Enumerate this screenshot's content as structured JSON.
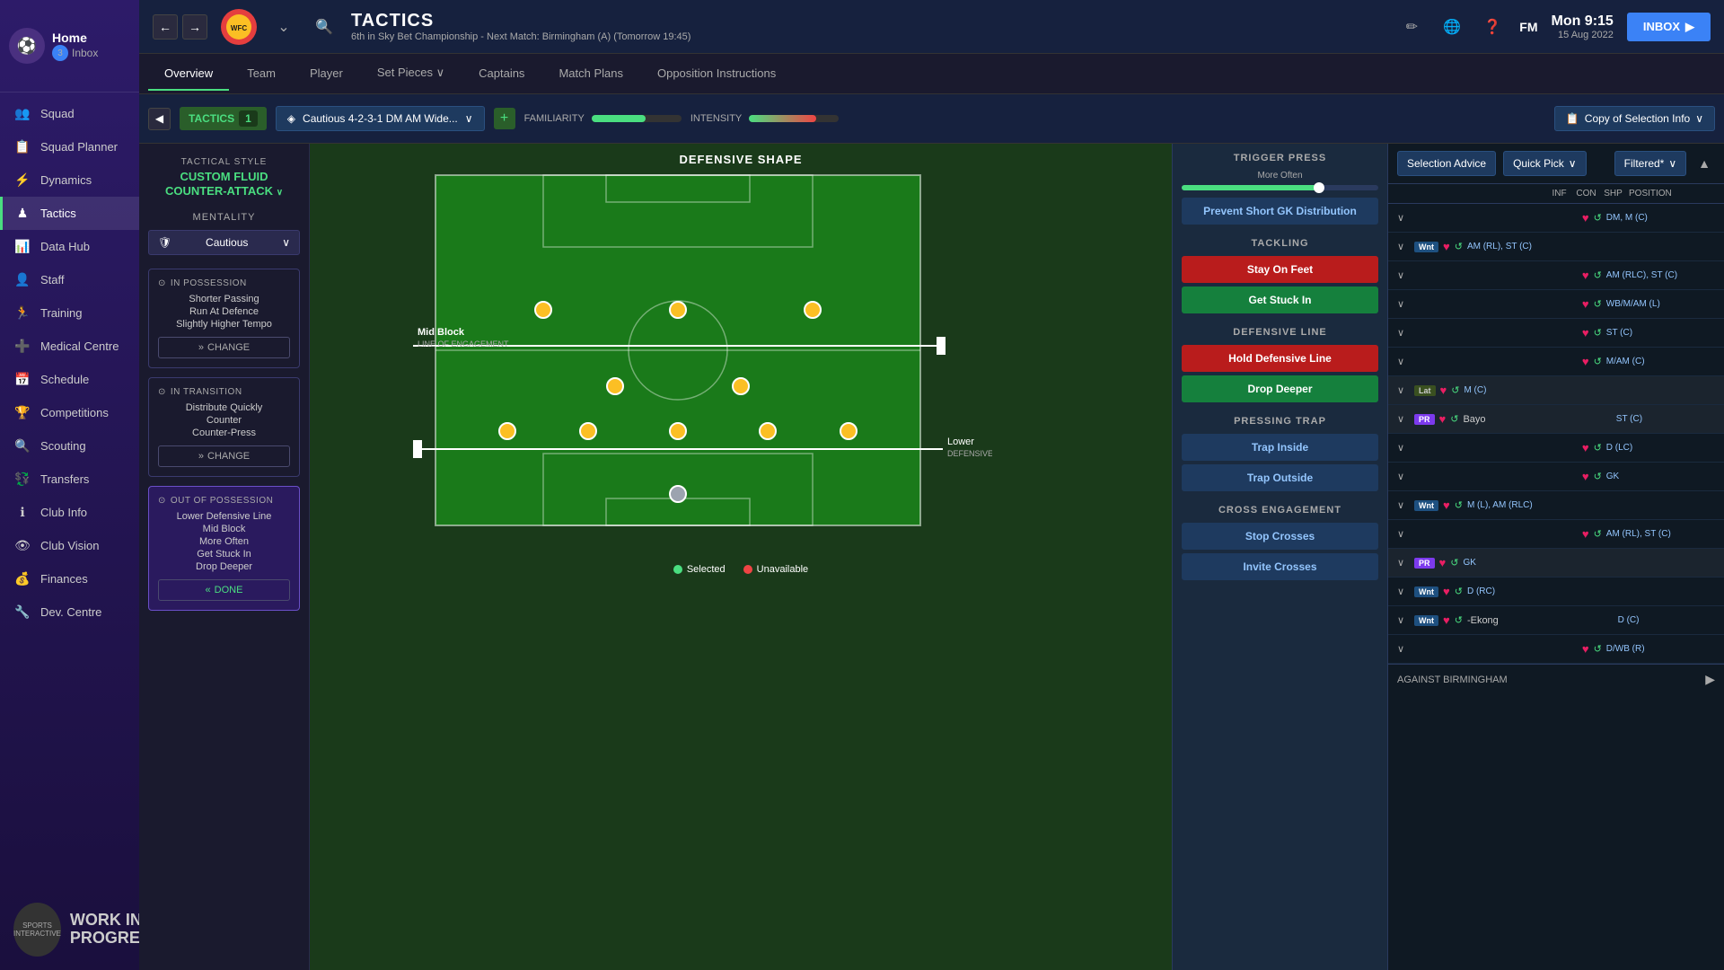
{
  "app": {
    "title": "TACTICS",
    "subtitle": "6th in Sky Bet Championship - Next Match: Birmingham (A) (Tomorrow 19:45)",
    "time": "Mon 9:15",
    "date": "15 Aug 2022",
    "fm_label": "FM",
    "inbox_label": "INBOX"
  },
  "sidebar": {
    "home_label": "Home",
    "inbox_label": "Inbox",
    "inbox_count": "3",
    "items": [
      {
        "label": "Squad",
        "icon": "👥"
      },
      {
        "label": "Squad Planner",
        "icon": "📋"
      },
      {
        "label": "Dynamics",
        "icon": "⚡"
      },
      {
        "label": "Tactics",
        "icon": "♟"
      },
      {
        "label": "Data Hub",
        "icon": "📊"
      },
      {
        "label": "Staff",
        "icon": "👤"
      },
      {
        "label": "Training",
        "icon": "🏃"
      },
      {
        "label": "Medical Centre",
        "icon": "➕"
      },
      {
        "label": "Schedule",
        "icon": "📅"
      },
      {
        "label": "Competitions",
        "icon": "🏆"
      },
      {
        "label": "Scouting",
        "icon": "🔍"
      },
      {
        "label": "Transfers",
        "icon": "💱"
      },
      {
        "label": "Club Info",
        "icon": "ℹ"
      },
      {
        "label": "Club Vision",
        "icon": "👁"
      },
      {
        "label": "Finances",
        "icon": "💰"
      },
      {
        "label": "Dev. Centre",
        "icon": "🔧"
      }
    ]
  },
  "secondnav": {
    "tabs": [
      "Overview",
      "Team",
      "Player",
      "Set Pieces",
      "Captains",
      "Match Plans",
      "Opposition Instructions"
    ]
  },
  "tacticsbar": {
    "label": "TACTICS",
    "num": "1",
    "formation": "Cautious 4-2-3-1 DM AM Wide...",
    "familiarity_label": "FAMILIARITY",
    "intensity_label": "INTENSITY",
    "copy_sel_label": "Copy of Selection Info"
  },
  "left_panel": {
    "tac_style_label": "TACTICAL STYLE",
    "tac_style_name": "CUSTOM FLUID\nCOUNTER-ATTACK",
    "mentality_label": "MENTALITY",
    "mentality_val": "Cautious",
    "in_possession_title": "IN POSSESSION",
    "in_possession_items": [
      "Shorter Passing",
      "Run At Defence",
      "Slightly Higher Tempo"
    ],
    "change_label": "CHANGE",
    "in_transition_title": "IN TRANSITION",
    "in_transition_items": [
      "Distribute Quickly",
      "Counter",
      "Counter-Press"
    ],
    "out_of_possession_title": "OUT OF POSSESSION",
    "out_of_possession_items": [
      "Lower Defensive Line",
      "Mid Block",
      "More Often",
      "Get Stuck In",
      "Drop Deeper"
    ],
    "done_label": "DONE"
  },
  "pitch": {
    "title": "DEFENSIVE SHAPE",
    "mid_block_label": "Mid Block",
    "line_of_engagement": "LINE OF ENGAGEMENT",
    "lower_def_label": "Lower",
    "defensive_line_label": "DEFENSIVE LINE",
    "selected_label": "Selected",
    "unavailable_label": "Unavailable"
  },
  "right_panel": {
    "trigger_press_title": "TRIGGER PRESS",
    "trigger_press_val": "More Often",
    "prevent_dist_btn": "Prevent Short GK Distribution",
    "tackling_title": "TACKLING",
    "stay_on_feet_btn": "Stay On Feet",
    "get_stuck_in_btn": "Get Stuck In",
    "defensive_line_title": "DEFENSIVE LINE",
    "hold_defensive_btn": "Hold Defensive Line",
    "drop_deeper_btn": "Drop Deeper",
    "pressing_trap_title": "PRESSING TRAP",
    "trap_inside_btn": "Trap Inside",
    "trap_outside_btn": "Trap Outside",
    "cross_engagement_title": "CROSS ENGAGEMENT",
    "stop_crosses_btn": "Stop Crosses",
    "invite_crosses_btn": "Invite Crosses"
  },
  "selection_panel": {
    "advice_label": "Selection Advice",
    "quick_pick_label": "Quick Pick",
    "filtered_label": "Filtered*",
    "col_inf": "INF",
    "col_con": "CON",
    "col_shp": "SHP",
    "col_pos": "POSITION",
    "players": [
      {
        "badge": "",
        "name": "",
        "pos": "DM, M (C)",
        "expand": true
      },
      {
        "badge": "Wnt",
        "name": "",
        "pos": "AM (RL), ST (C)",
        "expand": true
      },
      {
        "badge": "",
        "name": "",
        "pos": "AM (RLC), ST (C)",
        "expand": true
      },
      {
        "badge": "",
        "name": "",
        "pos": "WB/M/AM (L)",
        "expand": true
      },
      {
        "badge": "",
        "name": "",
        "pos": "ST (C)",
        "expand": true
      },
      {
        "badge": "",
        "name": "",
        "pos": "M/AM (C)",
        "expand": true
      },
      {
        "badge": "Lat",
        "name": "",
        "pos": "M (C)",
        "expand": true
      },
      {
        "badge": "PR",
        "name": "Bayo",
        "pos": "ST (C)",
        "expand": true
      },
      {
        "badge": "",
        "name": "",
        "pos": "D (LC)",
        "expand": true
      },
      {
        "badge": "",
        "name": "",
        "pos": "GK",
        "expand": true
      },
      {
        "badge": "Wnt",
        "name": "",
        "pos": "M (L), AM (RLC)",
        "expand": true
      },
      {
        "badge": "",
        "name": "",
        "pos": "AM (RL), ST (C)",
        "expand": true
      },
      {
        "badge": "PR",
        "name": "",
        "pos": "GK",
        "expand": true
      },
      {
        "badge": "Wnt",
        "name": "",
        "pos": "D (RC)",
        "expand": true
      },
      {
        "badge": "Wnt",
        "name": "-Ekong",
        "pos": "D (C)",
        "expand": true
      },
      {
        "badge": "",
        "name": "",
        "pos": "D/WB (R)",
        "expand": true
      }
    ],
    "against_label": "AGAINST BIRMINGHAM"
  }
}
